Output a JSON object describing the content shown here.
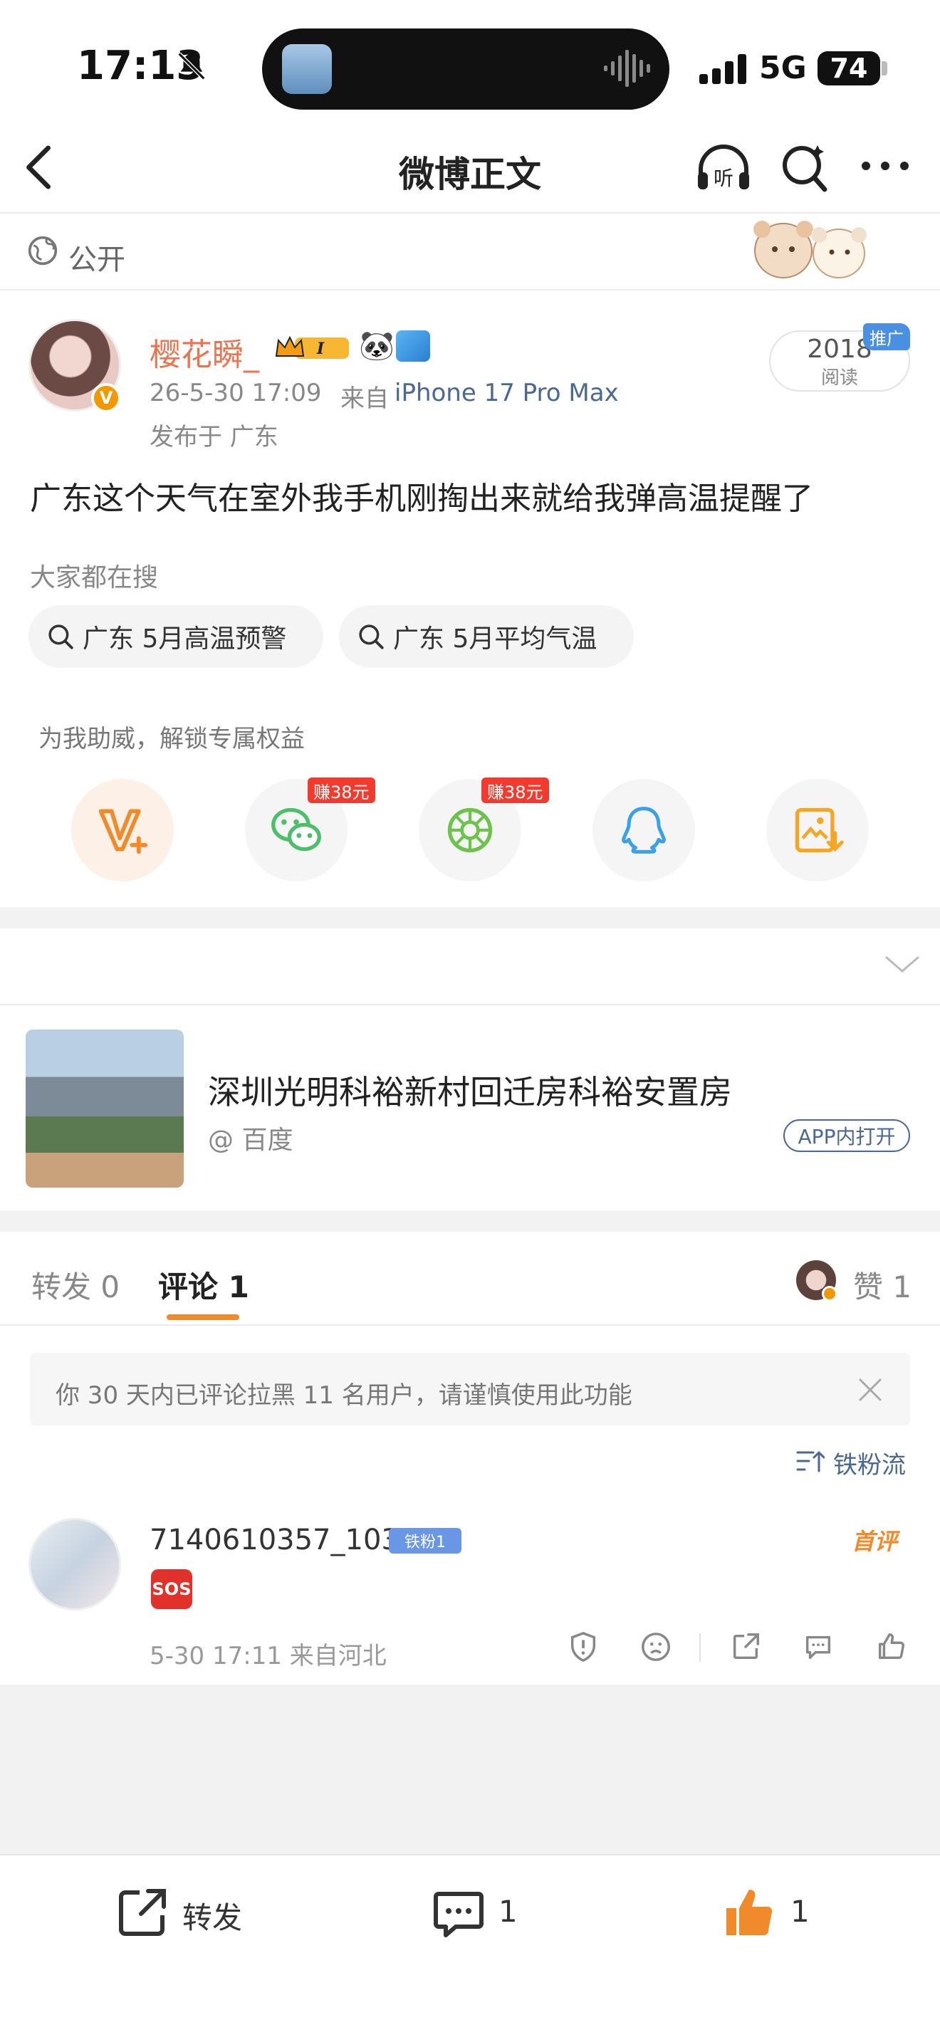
{
  "status_bar": {
    "time": "17:13",
    "network": "5G",
    "battery": "74"
  },
  "nav": {
    "title": "微博正文"
  },
  "visibility": {
    "label": "公开"
  },
  "post": {
    "username": "樱花瞬_",
    "time": "26-5-30 17:09",
    "source_label": "来自",
    "device": "iPhone 17 Pro Max",
    "location": "发布于 广东",
    "reads_count": "2018",
    "reads_label": "阅读",
    "promo_tag": "推广",
    "text": "广东这个天气在室外我手机刚掏出来就给我弹高温提醒了"
  },
  "hot_search": {
    "label": "大家都在搜",
    "chips": [
      "广东 5月高温预警",
      "广东 5月平均气温"
    ]
  },
  "share": {
    "boost_label": "为我助威，解锁专属权益",
    "earn_tag": "赚38元",
    "icons": [
      "vplus-icon",
      "wechat-icon",
      "moments-icon",
      "qq-icon",
      "save-image-icon"
    ]
  },
  "link_card": {
    "title": "深圳光明科裕新村回迁房科裕安置房",
    "source": "@ 百度",
    "open_button": "APP内打开"
  },
  "tabs": {
    "repost": "转发 0",
    "comment": "评论 1",
    "like": "赞 1"
  },
  "notice": {
    "text": "你 30 天内已评论拉黑 11 名用户，请谨慎使用此功能"
  },
  "sort": {
    "label": "铁粉流"
  },
  "comment": {
    "username": "7140610357_103",
    "fan_badge": "铁粉1",
    "first_badge": "首评",
    "emoji": "SOS",
    "meta": "5-30 17:11  来自河北"
  },
  "bottom_bar": {
    "repost_label": "转发",
    "comment_count": "1",
    "like_count": "1"
  },
  "colors": {
    "accent_orange": "#eb7350",
    "link_blue": "#4a6891",
    "earn_red": "#f23b2e"
  }
}
